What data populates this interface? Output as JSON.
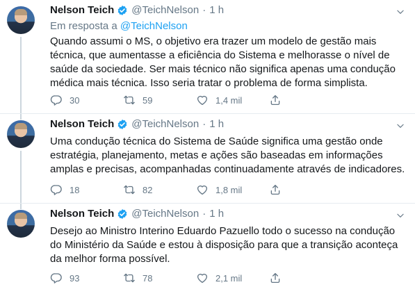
{
  "tweets": [
    {
      "author_name": "Nelson Teich",
      "handle": "@TeichNelson",
      "separator": "·",
      "time": "1 h",
      "reply_prefix": "Em resposta a",
      "reply_handle": "@TeichNelson",
      "text": "Quando assumi o MS, o objetivo era trazer um modelo de gestão mais\ntécnica, que aumentasse a eficiência do Sistema e melhorasse o nível de\nsaúde da sociedade. Ser mais técnico não significa apenas uma condução\nmédica mais técnica. Isso seria tratar o problema de forma simplista.",
      "replies": "30",
      "retweets": "59",
      "likes": "1,4 mil"
    },
    {
      "author_name": "Nelson Teich",
      "handle": "@TeichNelson",
      "separator": "·",
      "time": "1 h",
      "text": "Uma condução técnica do Sistema de Saúde significa uma gestão onde\nestratégia, planejamento, metas e ações são baseadas em informações\namplas e precisas, acompanhadas continuadamente através de indicadores.",
      "replies": "18",
      "retweets": "82",
      "likes": "1,8 mil"
    },
    {
      "author_name": "Nelson Teich",
      "handle": "@TeichNelson",
      "separator": "·",
      "time": "1 h",
      "text": "Desejo ao Ministro Interino Eduardo Pazuello todo o sucesso na condução\ndo Ministério da Saúde e estou à disposição para que a transição aconteça\nda melhor forma possível.",
      "replies": "93",
      "retweets": "78",
      "likes": "2,1 mil"
    }
  ],
  "colors": {
    "accent": "#1da1f2",
    "text": "#14171a",
    "secondary": "#657786",
    "thread_line": "#ccd6dd",
    "divider": "#e6ecf0"
  },
  "icons": [
    "verified-badge-icon",
    "caret-down-icon",
    "reply-icon",
    "retweet-icon",
    "like-icon",
    "share-icon"
  ]
}
